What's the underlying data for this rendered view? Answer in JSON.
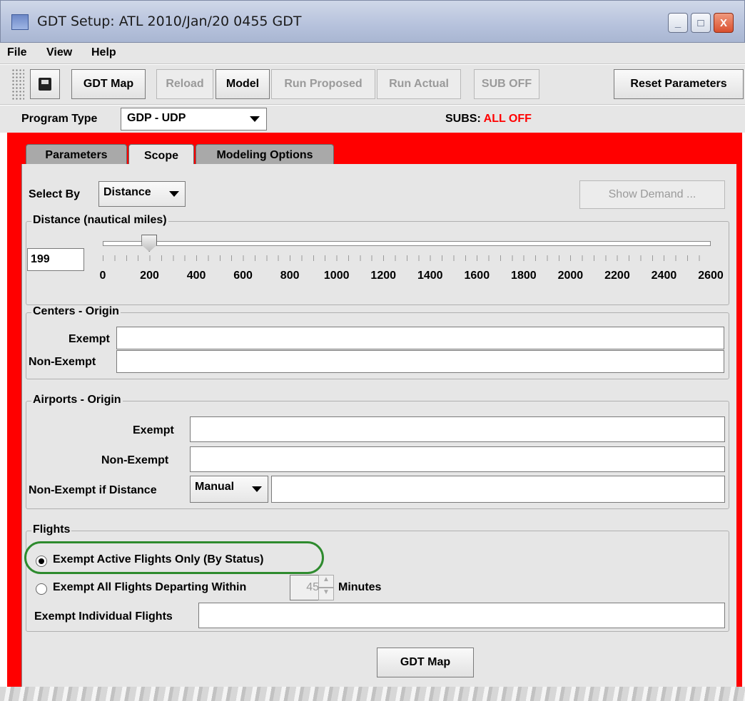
{
  "window": {
    "title": "GDT Setup: ATL 2010/Jan/20 0455 GDT",
    "controls": [
      "_",
      "□",
      "X"
    ]
  },
  "menu": [
    "File",
    "View",
    "Help"
  ],
  "toolbar": {
    "save_icon": "save-icon",
    "gdt_map": "GDT Map",
    "reload": "Reload",
    "model": "Model",
    "run_proposed": "Run Proposed",
    "run_actual": "Run Actual",
    "sub_off": "SUB OFF",
    "reset_parameters": "Reset Parameters"
  },
  "program": {
    "label": "Program Type",
    "value": "GDP - UDP",
    "subs_label": "SUBS:",
    "subs_value": "ALL OFF",
    "subs_color": "#ff0000"
  },
  "tabs": [
    "Parameters",
    "Scope",
    "Modeling Options"
  ],
  "scope": {
    "select_by_label": "Select By",
    "select_by_value": "Distance",
    "show_demand": "Show Demand ...",
    "distance": {
      "group_label": "Distance (nautical miles)",
      "value": "199",
      "slider_min": 0,
      "slider_max": 2600,
      "slider_value": 199,
      "ticks": [
        "0",
        "200",
        "400",
        "600",
        "800",
        "1000",
        "1200",
        "1400",
        "1600",
        "1800",
        "2000",
        "2200",
        "2400",
        "2600"
      ]
    },
    "centers_origin": {
      "group_label": "Centers - Origin",
      "exempt_label": "Exempt",
      "exempt_value": "",
      "non_exempt_label": "Non-Exempt",
      "non_exempt_value": ""
    },
    "airports_origin": {
      "group_label": "Airports - Origin",
      "exempt_label": "Exempt",
      "exempt_value": "",
      "non_exempt_label": "Non-Exempt",
      "non_exempt_value": "",
      "non_exempt_if_distance_label": "Non-Exempt if Distance",
      "manual_option": "Manual",
      "distance_value": ""
    },
    "flights": {
      "group_label": "Flights",
      "option_active": "Exempt Active Flights Only (By Status)",
      "option_departing": "Exempt All Flights Departing Within",
      "minutes_value": "45",
      "minutes_label": "Minutes",
      "individual_label": "Exempt Individual Flights",
      "individual_value": "",
      "selected": "option_active"
    },
    "gdt_map_button": "GDT Map"
  },
  "colors": {
    "frame": "#ff0000",
    "highlight_ring": "#2e8b2e"
  }
}
